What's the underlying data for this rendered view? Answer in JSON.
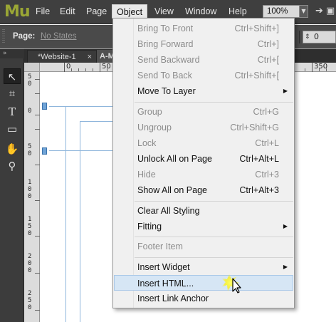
{
  "app": {
    "logo": "Mu",
    "menu": [
      {
        "label": "File",
        "active": false
      },
      {
        "label": "Edit",
        "active": false
      },
      {
        "label": "Page",
        "active": false
      },
      {
        "label": "Object",
        "active": true
      },
      {
        "label": "View",
        "active": false
      },
      {
        "label": "Window",
        "active": false
      },
      {
        "label": "Help",
        "active": false
      }
    ],
    "zoom": "100%"
  },
  "controlbar": {
    "page_label": "Page:",
    "page_value": "No States",
    "stepper_value": "0"
  },
  "tabs": [
    {
      "label": "*Website-1",
      "close": "×"
    },
    {
      "label": "A-M"
    }
  ],
  "ruler": {
    "h_labels": [
      "0",
      "50",
      "350"
    ],
    "v_labels": [
      "5 0",
      "0",
      "5 0",
      "1 0 0",
      "1 5 0",
      "2 0 0",
      "2 5 0"
    ]
  },
  "dropdown": {
    "items": [
      {
        "label": "Bring To Front",
        "shortcut": "Ctrl+Shift+]",
        "enabled": false
      },
      {
        "label": "Bring Forward",
        "shortcut": "Ctrl+]",
        "enabled": false
      },
      {
        "label": "Send Backward",
        "shortcut": "Ctrl+[",
        "enabled": false
      },
      {
        "label": "Send To Back",
        "shortcut": "Ctrl+Shift+[",
        "enabled": false
      },
      {
        "label": "Move To Layer",
        "shortcut": "",
        "enabled": true,
        "submenu": true
      },
      {
        "label": "Group",
        "shortcut": "Ctrl+G",
        "enabled": false
      },
      {
        "label": "Ungroup",
        "shortcut": "Ctrl+Shift+G",
        "enabled": false
      },
      {
        "label": "Lock",
        "shortcut": "Ctrl+L",
        "enabled": false
      },
      {
        "label": "Unlock All on Page",
        "shortcut": "Ctrl+Alt+L",
        "enabled": true
      },
      {
        "label": "Hide",
        "shortcut": "Ctrl+3",
        "enabled": false
      },
      {
        "label": "Show All on Page",
        "shortcut": "Ctrl+Alt+3",
        "enabled": true
      },
      {
        "label": "Clear All Styling",
        "shortcut": "",
        "enabled": true
      },
      {
        "label": "Fitting",
        "shortcut": "",
        "enabled": true,
        "submenu": true
      },
      {
        "label": "Footer Item",
        "shortcut": "",
        "enabled": false
      },
      {
        "label": "Insert Widget",
        "shortcut": "",
        "enabled": true,
        "submenu": true
      },
      {
        "label": "Insert HTML...",
        "shortcut": "",
        "enabled": true,
        "highlighted": true
      },
      {
        "label": "Insert Link Anchor",
        "shortcut": "",
        "enabled": true
      }
    ]
  },
  "colors": {
    "logo": "#9aa635",
    "menubar": "#3f3f3f",
    "highlight": "#d6e6f5",
    "guide": "#8fb6dc",
    "cursor_glow": "#fff200"
  }
}
